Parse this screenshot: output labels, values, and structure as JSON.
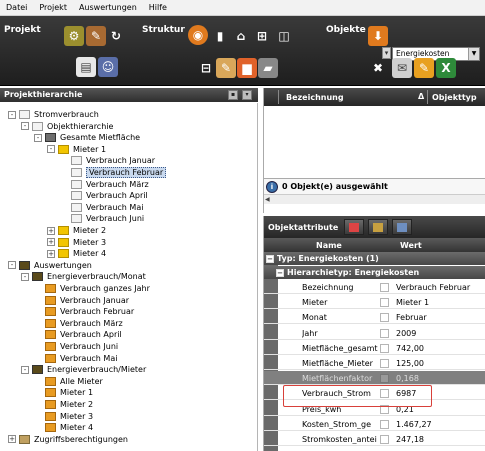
{
  "menu": [
    "Datei",
    "Projekt",
    "Auswertungen",
    "Hilfe"
  ],
  "toolbar": {
    "groups": [
      "Projekt",
      "Struktur",
      "Objekte"
    ],
    "object_select": "Energiekosten"
  },
  "left_panel": {
    "title": "Projekthierarchie"
  },
  "tree": [
    {
      "label": "Stromverbrauch",
      "level": 0,
      "exp": "-",
      "icon": "doc",
      "selected": false
    },
    {
      "label": "Objekthierarchie",
      "level": 1,
      "exp": "-",
      "icon": "doc",
      "selected": false
    },
    {
      "label": "Gesamte Mietfläche",
      "level": 2,
      "exp": "-",
      "icon": "house",
      "selected": false
    },
    {
      "label": "Mieter 1",
      "level": 3,
      "exp": "-",
      "icon": "person",
      "selected": false
    },
    {
      "label": "Verbrauch Januar",
      "level": 4,
      "exp": "",
      "icon": "doc",
      "selected": false
    },
    {
      "label": "Verbrauch Februar",
      "level": 4,
      "exp": "",
      "icon": "doc",
      "selected": true
    },
    {
      "label": "Verbrauch März",
      "level": 4,
      "exp": "",
      "icon": "doc",
      "selected": false
    },
    {
      "label": "Verbrauch April",
      "level": 4,
      "exp": "",
      "icon": "doc",
      "selected": false
    },
    {
      "label": "Verbrauch Mai",
      "level": 4,
      "exp": "",
      "icon": "doc",
      "selected": false
    },
    {
      "label": "Verbrauch Juni",
      "level": 4,
      "exp": "",
      "icon": "doc",
      "selected": false
    },
    {
      "label": "Mieter 2",
      "level": 3,
      "exp": "+",
      "icon": "person",
      "selected": false
    },
    {
      "label": "Mieter 3",
      "level": 3,
      "exp": "+",
      "icon": "person",
      "selected": false
    },
    {
      "label": "Mieter 4",
      "level": 3,
      "exp": "+",
      "icon": "person",
      "selected": false
    },
    {
      "label": "Auswertungen",
      "level": 0,
      "exp": "-",
      "icon": "dark",
      "selected": false
    },
    {
      "label": "Energieverbrauch/Monat",
      "level": 1,
      "exp": "-",
      "icon": "dark",
      "selected": false
    },
    {
      "label": "Verbrauch ganzes Jahr",
      "level": 2,
      "exp": "",
      "icon": "folder",
      "selected": false
    },
    {
      "label": "Verbrauch Januar",
      "level": 2,
      "exp": "",
      "icon": "folder",
      "selected": false
    },
    {
      "label": "Verbrauch Februar",
      "level": 2,
      "exp": "",
      "icon": "folder",
      "selected": false
    },
    {
      "label": "Verbrauch März",
      "level": 2,
      "exp": "",
      "icon": "folder",
      "selected": false
    },
    {
      "label": "Verbrauch April",
      "level": 2,
      "exp": "",
      "icon": "folder",
      "selected": false
    },
    {
      "label": "Verbrauch Juni",
      "level": 2,
      "exp": "",
      "icon": "folder",
      "selected": false
    },
    {
      "label": "Verbrauch Mai",
      "level": 2,
      "exp": "",
      "icon": "folder",
      "selected": false
    },
    {
      "label": "Energieverbrauch/Mieter",
      "level": 1,
      "exp": "-",
      "icon": "dark",
      "selected": false
    },
    {
      "label": "Alle Mieter",
      "level": 2,
      "exp": "",
      "icon": "folder",
      "selected": false
    },
    {
      "label": "Mieter 1",
      "level": 2,
      "exp": "",
      "icon": "folder",
      "selected": false
    },
    {
      "label": "Mieter 2",
      "level": 2,
      "exp": "",
      "icon": "folder",
      "selected": false
    },
    {
      "label": "Mieter 3",
      "level": 2,
      "exp": "",
      "icon": "folder",
      "selected": false
    },
    {
      "label": "Mieter 4",
      "level": 2,
      "exp": "",
      "icon": "folder",
      "selected": false
    },
    {
      "label": "Zugriffsberechtigungen",
      "level": 0,
      "exp": "+",
      "icon": "key",
      "selected": false
    }
  ],
  "object_list": {
    "col_name": "Bezeichnung",
    "sort": "Δ",
    "col_type": "Objekttyp",
    "status": "0 Objekt(e) ausgewählt"
  },
  "attributes": {
    "title": "Objektattribute",
    "col_name": "Name",
    "col_value": "Wert",
    "group1": "Typ: Energiekosten (1)",
    "group2": "Hierarchietyp: Energiekosten",
    "rows": [
      {
        "name": "Bezeichnung",
        "value": "Verbrauch Februar",
        "readonly": false
      },
      {
        "name": "Mieter",
        "value": "Mieter 1",
        "readonly": false
      },
      {
        "name": "Monat",
        "value": "Februar",
        "readonly": false
      },
      {
        "name": "Jahr",
        "value": "2009",
        "readonly": false
      },
      {
        "name": "Mietfläche_gesamt",
        "value": "742,00",
        "readonly": false
      },
      {
        "name": "Mietfläche_Mieter",
        "value": "125,00",
        "readonly": false
      },
      {
        "name": "Mietflächenfaktor",
        "value": "0,168",
        "readonly": true
      },
      {
        "name": "Verbrauch_Strom",
        "value": "6987",
        "readonly": false
      },
      {
        "name": "Preis_kwh",
        "value": "0,21",
        "readonly": false
      },
      {
        "name": "Kosten_Strom_ge",
        "value": "1.467,27",
        "readonly": false
      },
      {
        "name": "Stromkosten_antei",
        "value": "247,18",
        "readonly": false
      }
    ]
  }
}
